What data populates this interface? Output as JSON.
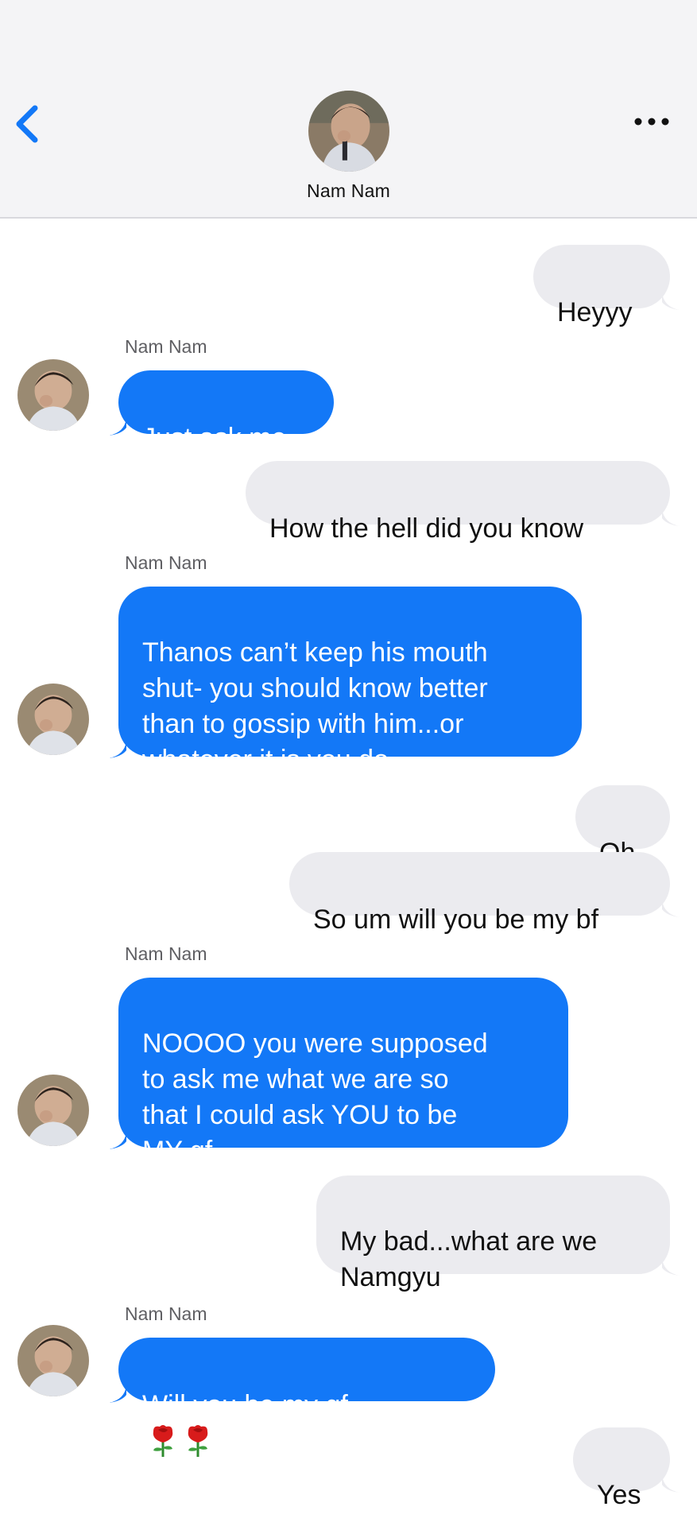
{
  "header": {
    "contact_name": "Nam Nam",
    "back_icon": "chevron-left-icon",
    "more_icon": "ellipsis-icon",
    "accent_color": "#1378f7"
  },
  "messages": [
    {
      "direction": "out",
      "text": "Heyyy"
    },
    {
      "direction": "in",
      "sender": "Nam Nam",
      "text": "Just ask me"
    },
    {
      "direction": "out",
      "text": "How the hell did you know"
    },
    {
      "direction": "in",
      "sender": "Nam Nam",
      "text": "Thanos can’t keep his mouth\nshut- you should know better\nthan to gossip with him...or\nwhatever it is you do"
    },
    {
      "direction": "out",
      "text": "Oh"
    },
    {
      "direction": "out",
      "text": "So um will you be my bf"
    },
    {
      "direction": "in",
      "sender": "Nam Nam",
      "text": "NOOOO you were supposed\nto ask me what we are so\nthat I could ask YOU to be\nMY gf"
    },
    {
      "direction": "out",
      "text": "My bad...what are we\nNamgyu"
    },
    {
      "direction": "in",
      "sender": "Nam Nam",
      "text": "Will you be my gf",
      "emoji": "rose-icon rose-icon"
    },
    {
      "direction": "out",
      "text": "Yes"
    }
  ],
  "colors": {
    "incoming_bubble": "#1378f7",
    "outgoing_bubble": "#ebebef",
    "header_bg": "#f4f4f6"
  }
}
